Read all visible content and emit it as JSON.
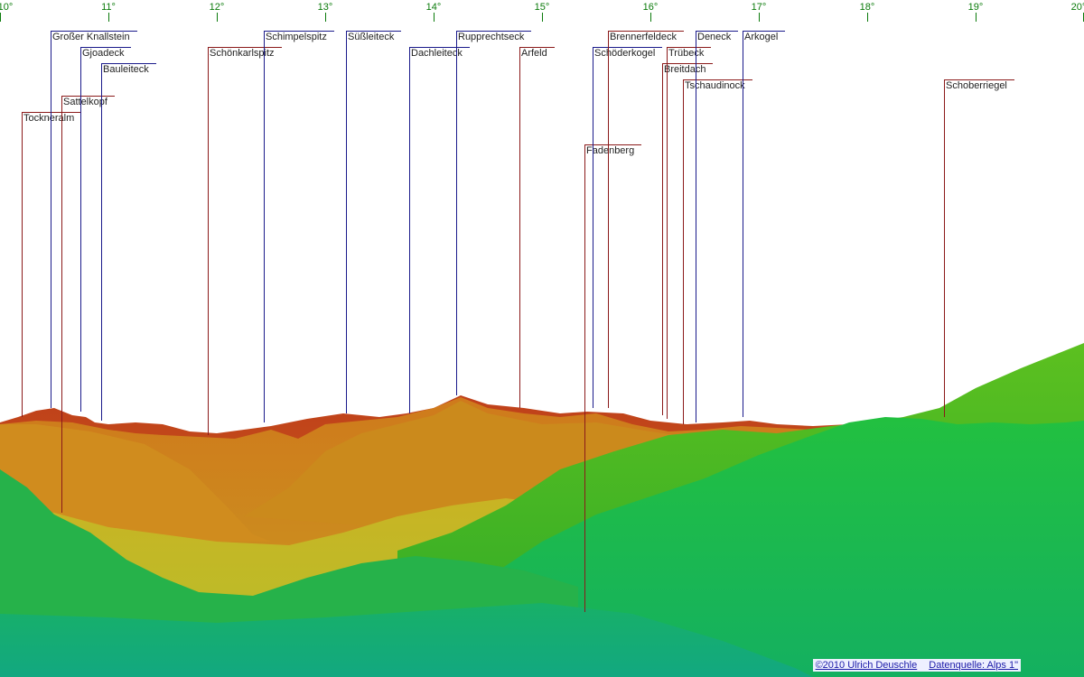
{
  "scale": {
    "labels": [
      "10°",
      "11°",
      "12°",
      "13°",
      "14°",
      "15°",
      "16°",
      "17°",
      "18°",
      "19°",
      "20°"
    ]
  },
  "peaks": [
    {
      "name": "Tockneralm",
      "row": 6,
      "color": "#8b1a1a"
    },
    {
      "name": "Großer Knallstein",
      "row": 1,
      "color": "#1a1a8b"
    },
    {
      "name": "Sattelkopf",
      "row": 5,
      "color": "#8b1a1a"
    },
    {
      "name": "Gjoadeck",
      "row": 2,
      "color": "#1a1a8b"
    },
    {
      "name": "Bauleiteck",
      "row": 3,
      "color": "#1a1a8b"
    },
    {
      "name": "Schönkarlspitz",
      "row": 2,
      "color": "#8b1a1a"
    },
    {
      "name": "Schimpelspitz",
      "row": 1,
      "color": "#1a1a8b"
    },
    {
      "name": "Süßleiteck",
      "row": 1,
      "color": "#1a1a8b"
    },
    {
      "name": "Dachleiteck",
      "row": 2,
      "color": "#1a1a8b"
    },
    {
      "name": "Rupprechtseck",
      "row": 1,
      "color": "#1a1a8b"
    },
    {
      "name": "Arfeld",
      "row": 2,
      "color": "#8b1a1a"
    },
    {
      "name": "Fadenberg",
      "row": 8,
      "color": "#8b1a1a"
    },
    {
      "name": "Schöderkogel",
      "row": 2,
      "color": "#1a1a8b"
    },
    {
      "name": "Brennerfeldeck",
      "row": 1,
      "color": "#8b1a1a"
    },
    {
      "name": "Breitdach",
      "row": 3,
      "color": "#8b1a1a"
    },
    {
      "name": "Trübeck",
      "row": 2,
      "color": "#8b1a1a"
    },
    {
      "name": "Tschaudinock",
      "row": 4,
      "color": "#8b1a1a"
    },
    {
      "name": "Deneck",
      "row": 1,
      "color": "#1a1a8b"
    },
    {
      "name": "Arkogel",
      "row": 1,
      "color": "#1a1a8b"
    },
    {
      "name": "Schoberriegel",
      "row": 4,
      "color": "#8b1a1a"
    }
  ],
  "credits": {
    "author": "©2010 Ulrich Deuschle",
    "source": "Datenquelle: Alps 1\""
  }
}
